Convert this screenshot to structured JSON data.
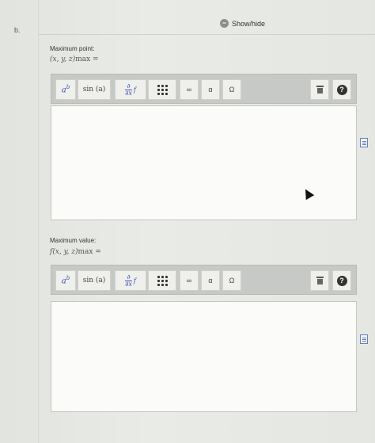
{
  "part": {
    "label": "b."
  },
  "show_hide": {
    "label": "Show/hide",
    "icon": "minus-circle-icon"
  },
  "sections": [
    {
      "label": "Maximum point:",
      "expr": {
        "vars": "(x, y, z)",
        "sub": "max",
        "eq": " ="
      },
      "toolbar": {
        "power": {
          "base": "a",
          "exp": "b"
        },
        "sin": "sin (a)",
        "deriv": {
          "num": "∂",
          "den": "∂x",
          "f": "f"
        },
        "infinity": "∞",
        "alpha": "α",
        "omega": "Ω",
        "help": "?"
      }
    },
    {
      "label": "Maximum value:",
      "expr": {
        "vars": "f(x, y, z)",
        "sub": "max",
        "eq": " ="
      },
      "toolbar": {
        "power": {
          "base": "a",
          "exp": "b"
        },
        "sin": "sin (a)",
        "deriv": {
          "num": "∂",
          "den": "∂x",
          "f": "f"
        },
        "infinity": "∞",
        "alpha": "α",
        "omega": "Ω",
        "help": "?"
      }
    }
  ]
}
